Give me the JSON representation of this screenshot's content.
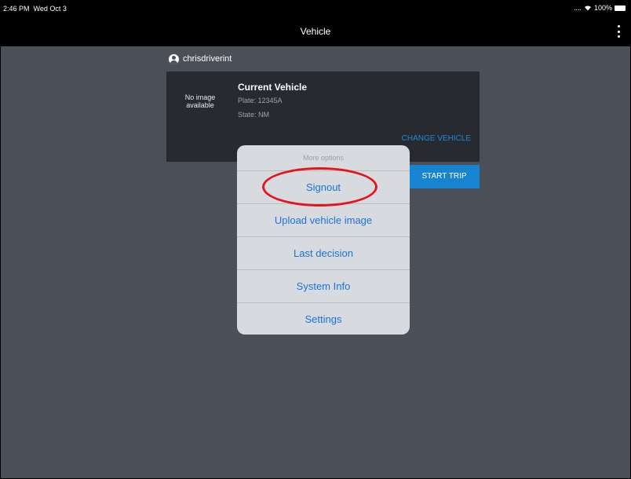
{
  "status_bar": {
    "time": "2:46 PM",
    "date": "Wed Oct 3",
    "signal": "....",
    "battery": "100%"
  },
  "nav": {
    "title": "Vehicle",
    "menu_icon": "more-vertical-icon"
  },
  "user": {
    "name": "chrisdriverint",
    "icon": "user-icon"
  },
  "vehicle_card": {
    "no_image_line1": "No image",
    "no_image_line2": "available",
    "title": "Current Vehicle",
    "plate": "Plate: 12345A",
    "state": "State: NM",
    "change_label": "CHANGE VEHICLE"
  },
  "start_trip_label": "START TRIP",
  "more_options": {
    "header": "More options",
    "items": [
      {
        "label": "Signout"
      },
      {
        "label": "Upload vehicle image"
      },
      {
        "label": "Last decision"
      },
      {
        "label": "System Info"
      },
      {
        "label": "Settings"
      }
    ]
  },
  "colors": {
    "accent": "#1a73d8",
    "annotation": "#e4141c",
    "background": "#4b4f57"
  }
}
